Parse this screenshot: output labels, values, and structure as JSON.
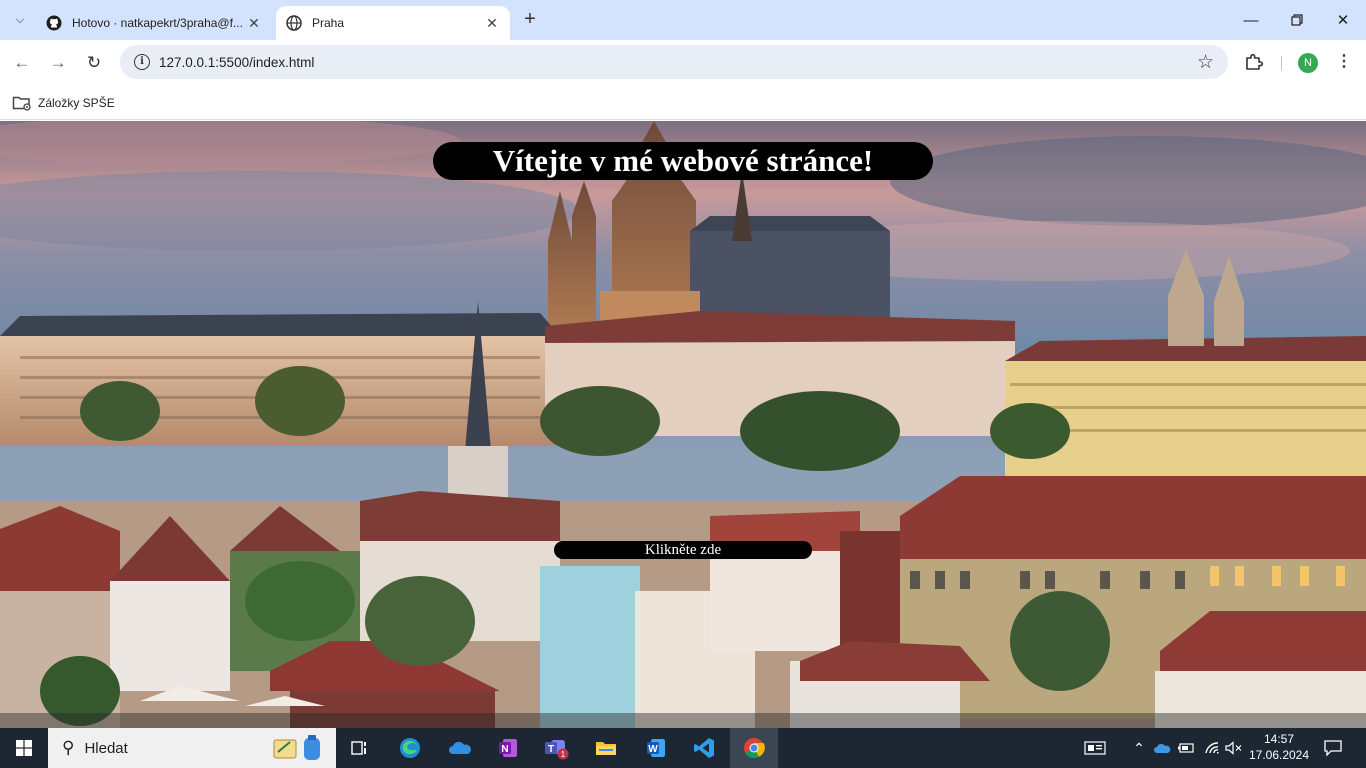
{
  "browser": {
    "tabs": [
      {
        "title": "Hotovo · natkapekrt/3praha@f...",
        "favicon": "github-icon",
        "active": false
      },
      {
        "title": "Praha",
        "favicon": "globe-icon",
        "active": true
      }
    ],
    "address": {
      "url": "127.0.0.1:5500/index.html"
    },
    "profile_initial": "N",
    "bookmarks": [
      {
        "label": "Záložky SPŠE",
        "icon": "managed-folder-icon"
      }
    ],
    "colors": {
      "tabstrip": "#d3e3fd",
      "omnibox": "#e9eef6",
      "profile": "#34a853"
    }
  },
  "page": {
    "title": "Vítejte v mé webové stránce!",
    "button_label": "Klikněte zde",
    "background": "Prague Castle panorama at dusk"
  },
  "taskbar": {
    "search_placeholder": "Hledat",
    "apps": [
      "task-view-icon",
      "edge-icon",
      "onedrive-icon",
      "onenote-icon",
      "teams-icon",
      "file-explorer-icon",
      "word-icon",
      "vscode-icon",
      "chrome-icon"
    ],
    "teams_badge": "1",
    "time": "14:57",
    "date": "17.06.2024",
    "colors": {
      "bar": "#1c2733",
      "search": "#f0f0f0"
    }
  }
}
